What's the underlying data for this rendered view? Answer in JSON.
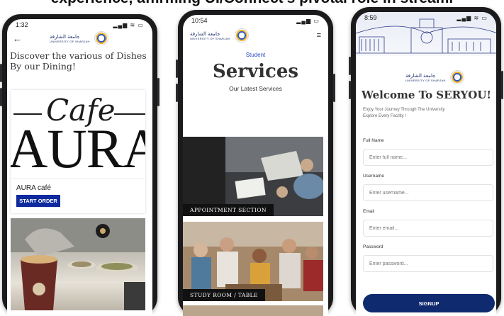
{
  "caption": "experience, affirming UI/Connect's pivotal role in streaml",
  "phone1": {
    "time": "1:32",
    "status_icons": "▂▄▆ ≋ ▭",
    "logo_ar": "جامعة الشارقة",
    "logo_en": "UNIVERSITY OF SHARJAH",
    "back_icon": "arrow-left-icon",
    "intro": "Discover the various of Dishes By our Dining!",
    "cafe_word": "Cafe",
    "aura_word": "AURA",
    "card_title": "AURA café",
    "start_label": "START ORDER"
  },
  "phone2": {
    "time": "10:54",
    "status_icons": "▂▄▆ ▭",
    "logo_ar": "جامعة الشارقة",
    "logo_en": "UNIVERSITY OF SHARJAH",
    "menu_icon": "hamburger-menu-icon",
    "student": "Student",
    "services": "Services",
    "latest": "Our Latest Services",
    "cards": [
      {
        "label": "APPOINTMENT SECTION"
      },
      {
        "label": "STUDY ROOM / TABLE"
      }
    ]
  },
  "phone3": {
    "time": "8:59",
    "status_icons": "▂▄▆ ≋ ▭",
    "logo_ar": "جامعة الشارقة",
    "logo_en": "UNIVERSITY OF SHARJAH",
    "welcome": "Welcome To SERYOU!",
    "sub_line1": "Enjoy Your Journey Through The University",
    "sub_line2": "Explore Every Facility !",
    "fields": [
      {
        "label": "Full Name",
        "placeholder": "Enter full name..."
      },
      {
        "label": "Username",
        "placeholder": "Enter username..."
      },
      {
        "label": "Email",
        "placeholder": "Enter email..."
      },
      {
        "label": "Password",
        "placeholder": "Enter password..."
      }
    ],
    "signup_label": "SIGNUP"
  },
  "colors": {
    "accent_blue": "#0f2a9e",
    "signup_navy": "#0f2a6e",
    "student_blue": "#2747c4"
  }
}
